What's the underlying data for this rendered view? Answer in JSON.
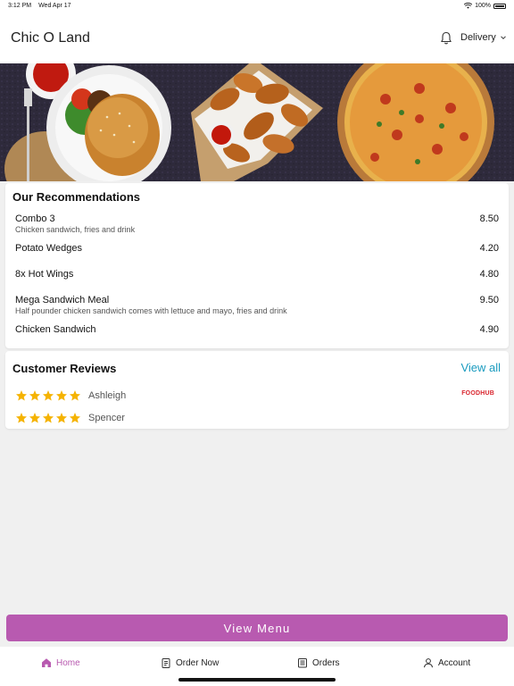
{
  "status_bar": {
    "time": "3:12 PM",
    "date": "Wed Apr 17",
    "battery": "100%"
  },
  "header": {
    "title": "Chic O Land",
    "bell_icon": "bell-icon",
    "delivery_label": "Delivery"
  },
  "recommendations": {
    "title": "Our Recommendations",
    "items": [
      {
        "name": "Combo 3",
        "description": "Chicken sandwich, fries and drink",
        "price": "8.50"
      },
      {
        "name": "Potato Wedges",
        "description": "",
        "price": "4.20"
      },
      {
        "name": "8x Hot Wings",
        "description": "",
        "price": "4.80"
      },
      {
        "name": "Mega Sandwich Meal",
        "description": "Half pounder chicken sandwich comes with lettuce and mayo, fries and drink",
        "price": "9.50"
      },
      {
        "name": "Chicken Sandwich",
        "description": "",
        "price": "4.90"
      }
    ]
  },
  "reviews": {
    "title": "Customer Reviews",
    "view_all": "View all",
    "source_logo": "FOODHUB",
    "items": [
      {
        "name": "Ashleigh",
        "rating": 5
      },
      {
        "name": "Spencer",
        "rating": 5
      }
    ]
  },
  "view_menu_label": "View Menu",
  "tabs": [
    {
      "label": "Home",
      "icon": "home-icon",
      "active": true
    },
    {
      "label": "Order Now",
      "icon": "order-icon",
      "active": false
    },
    {
      "label": "Orders",
      "icon": "orders-icon",
      "active": false
    },
    {
      "label": "Account",
      "icon": "account-icon",
      "active": false
    }
  ],
  "colors": {
    "accent": "#b85ab0",
    "link": "#1a9bbf",
    "star": "#f5b301"
  }
}
